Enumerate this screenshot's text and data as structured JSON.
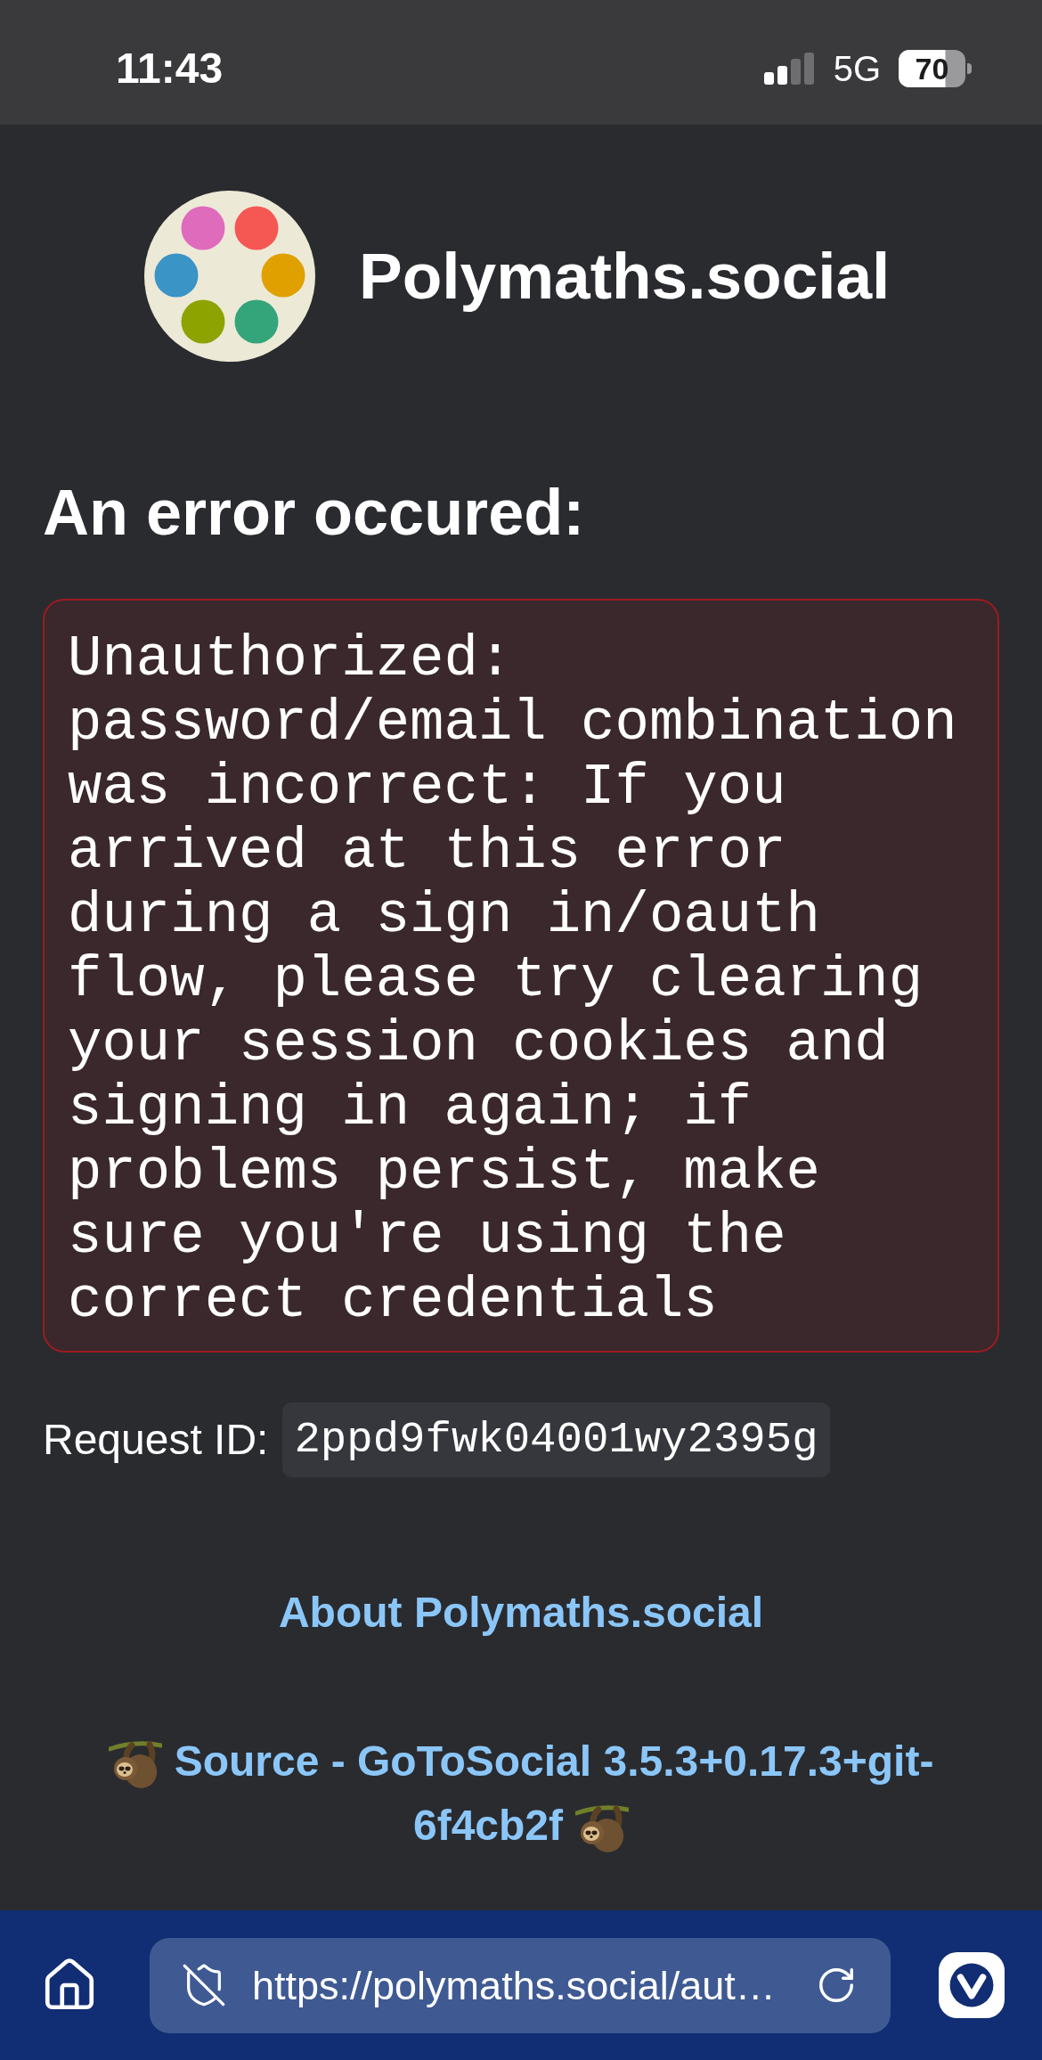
{
  "status_bar": {
    "time": "11:43",
    "network": "5G",
    "battery": "70"
  },
  "header": {
    "site_name": "Polymaths.social"
  },
  "error": {
    "heading": "An error occured:",
    "message": "Unauthorized: password/email combination was incorrect: If you arrived at this error during a sign in/oauth flow, please try clearing your session cookies and signing in again; if problems persist, make sure you're using the correct credentials"
  },
  "request_id": {
    "label": "Request ID:",
    "value": "2ppd9fwk04001wy2395g"
  },
  "footer": {
    "links": [
      {
        "kind": "plain",
        "text": "About Polymaths.social"
      },
      {
        "kind": "sloth",
        "text": "Source - GoToSocial 3.5.3+0.17.3+git-6f4cb2f"
      }
    ]
  },
  "browser_bar": {
    "url": "https://polymaths.social/aut…"
  }
}
